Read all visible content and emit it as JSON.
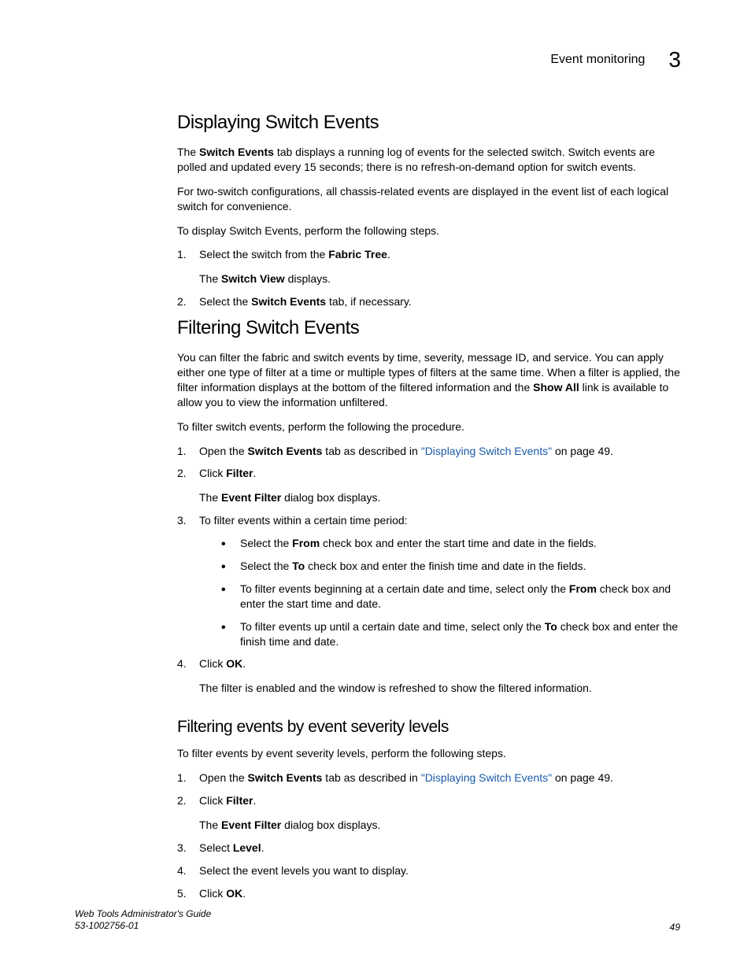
{
  "header": {
    "title": "Event monitoring",
    "chapter": "3"
  },
  "sections": {
    "s1": {
      "heading": "Displaying Switch Events",
      "p1a": "The ",
      "p1b": "Switch Events",
      "p1c": " tab displays a running log of events for the selected switch. Switch events are polled and updated every 15 seconds; there is no refresh-on-demand option for switch events.",
      "p2": "For two-switch configurations, all chassis-related events are displayed in the event list of each logical switch for convenience.",
      "p3": "To display Switch Events, perform the following steps.",
      "step1a": "Select the switch from the ",
      "step1b": "Fabric Tree",
      "step1c": ".",
      "step1suba": "The ",
      "step1subb": "Switch View",
      "step1subc": " displays.",
      "step2a": "Select the ",
      "step2b": "Switch Events",
      "step2c": " tab, if necessary."
    },
    "s2": {
      "heading": "Filtering Switch Events",
      "p1a": "You can filter the fabric and switch events by time, severity, message ID, and service. You can apply either one type of filter at a time or multiple types of filters at the same time. When a filter is applied, the filter information displays at the bottom of the filtered information and the ",
      "p1b": "Show All",
      "p1c": " link is available to allow you to view the information unfiltered.",
      "p2": "To filter switch events, perform the following the procedure.",
      "step1a": "Open the ",
      "step1b": "Switch Events",
      "step1c": " tab as described in ",
      "step1link": "\"Displaying Switch Events\"",
      "step1d": " on page 49.",
      "step2a": "Click ",
      "step2b": "Filter",
      "step2c": ".",
      "step2suba": "The ",
      "step2subb": "Event Filter",
      "step2subc": " dialog box displays.",
      "step3": "To filter events within a certain time period:",
      "bullet1a": "Select the ",
      "bullet1b": "From",
      "bullet1c": " check box and enter the start time and date in the fields.",
      "bullet2a": "Select the ",
      "bullet2b": "To",
      "bullet2c": " check box and enter the finish time and date in the fields.",
      "bullet3a": "To filter events beginning at a certain date and time, select only the ",
      "bullet3b": "From",
      "bullet3c": " check box and enter the start time and date.",
      "bullet4a": "To filter events up until a certain date and time, select only the ",
      "bullet4b": "To",
      "bullet4c": " check box and enter the finish time and date.",
      "step4a": "Click ",
      "step4b": "OK",
      "step4c": ".",
      "step4sub": "The filter is enabled and the window is refreshed to show the filtered information."
    },
    "s3": {
      "heading": "Filtering events by event severity levels",
      "p1": "To filter events by event severity levels, perform the following steps.",
      "step1a": "Open the ",
      "step1b": "Switch Events",
      "step1c": " tab as described in ",
      "step1link": "\"Displaying Switch Events\"",
      "step1d": " on page 49.",
      "step2a": "Click ",
      "step2b": "Filter",
      "step2c": ".",
      "step2suba": "The ",
      "step2subb": "Event Filter",
      "step2subc": " dialog box displays.",
      "step3a": "Select ",
      "step3b": "Level",
      "step3c": ".",
      "step4": "Select the event levels you want to display.",
      "step5a": "Click ",
      "step5b": "OK",
      "step5c": "."
    }
  },
  "footer": {
    "guide": "Web Tools Administrator's Guide",
    "docnum": "53-1002756-01",
    "page": "49"
  }
}
